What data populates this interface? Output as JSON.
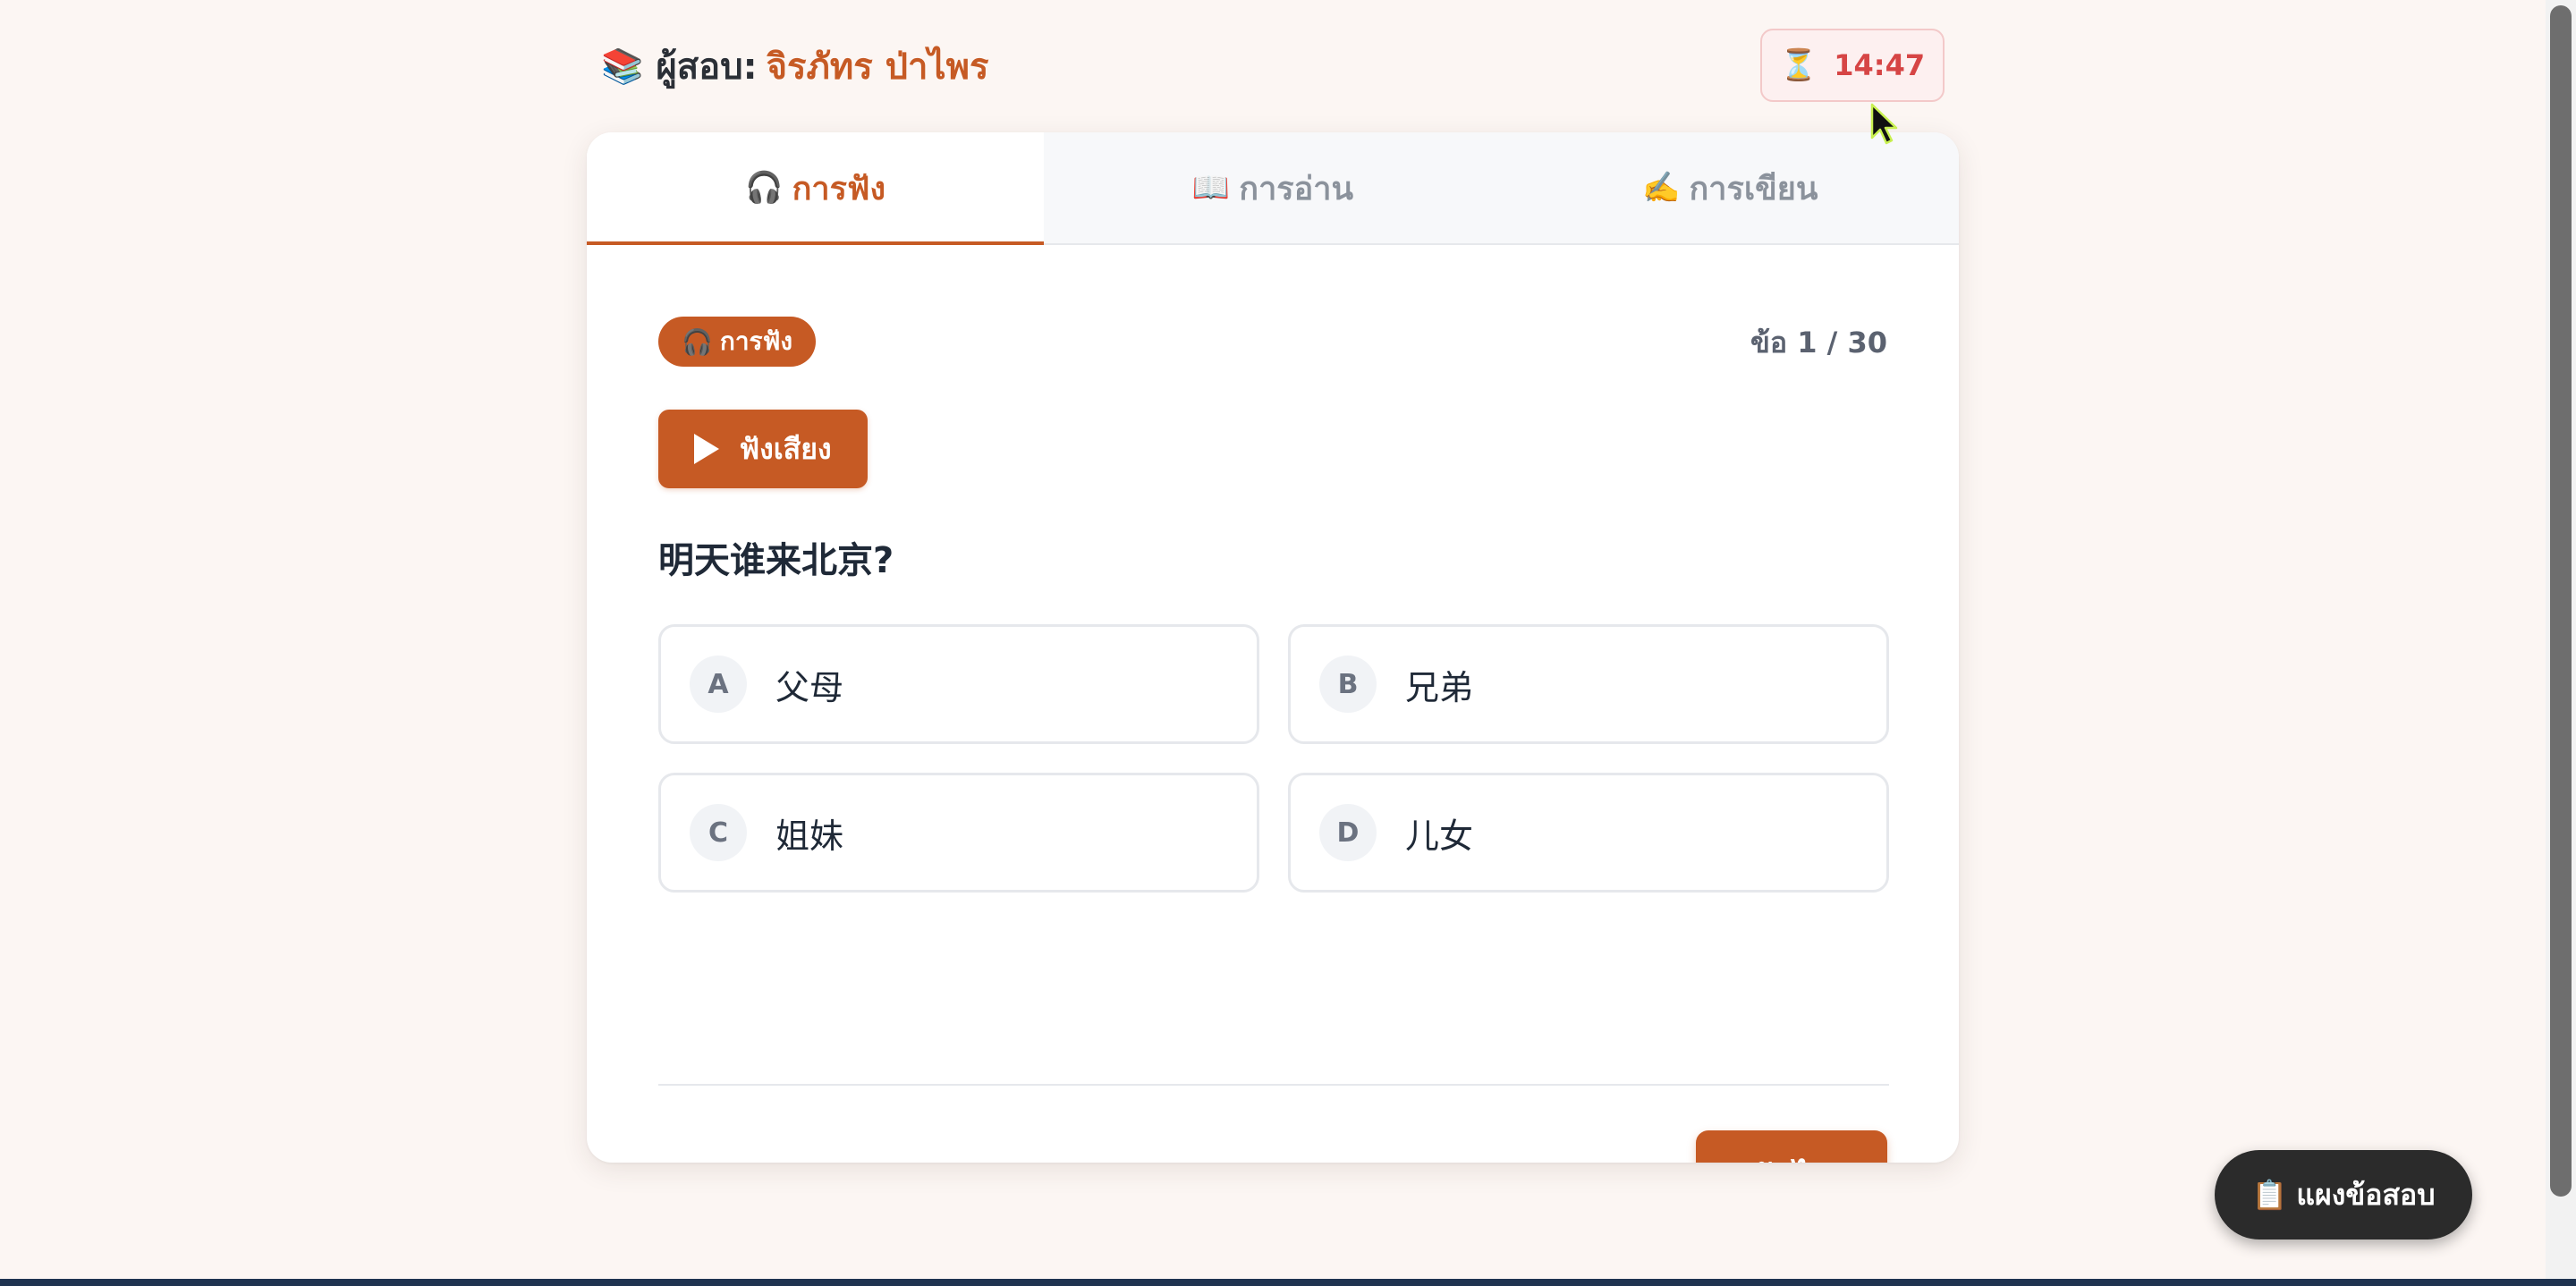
{
  "header": {
    "books_icon": "📚",
    "examinee_label": "ผู้สอบ:",
    "examinee_name": "จิรภัทร ป่าไพร",
    "timer_icon": "⏳",
    "timer_value": "14:47"
  },
  "tabs": [
    {
      "icon": "🎧",
      "label": "การฟัง",
      "active": true
    },
    {
      "icon": "📖",
      "label": "การอ่าน",
      "active": false
    },
    {
      "icon": "✍️",
      "label": "การเขียน",
      "active": false
    }
  ],
  "question": {
    "section_badge_icon": "🎧",
    "section_badge_label": "การฟัง",
    "counter": "ข้อ 1 / 30",
    "play_label": "ฟังเสียง",
    "text": "明天谁来北京?",
    "options": [
      {
        "letter": "A",
        "text": "父母"
      },
      {
        "letter": "B",
        "text": "兄弟"
      },
      {
        "letter": "C",
        "text": "姐妹"
      },
      {
        "letter": "D",
        "text": "儿女"
      }
    ]
  },
  "footer": {
    "next_label": "ถัดไป",
    "exam_map_icon": "📋",
    "exam_map_label": "แผงข้อสอบ"
  },
  "colors": {
    "accent": "#c65a24",
    "timer_text": "#d64545",
    "background": "#fcf6f3"
  }
}
